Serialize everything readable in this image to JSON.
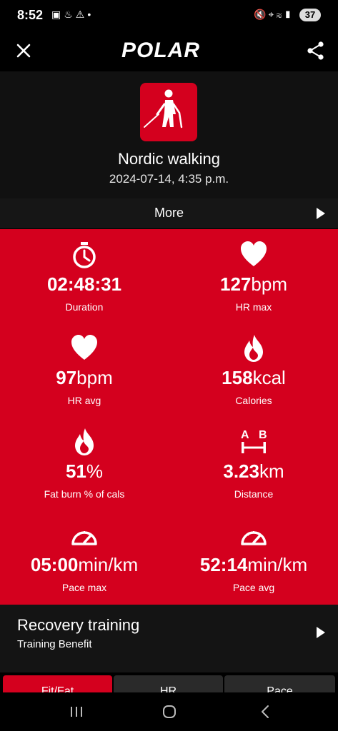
{
  "status_bar": {
    "time": "8:52",
    "left_icons": [
      "screenshot-icon",
      "flame-icon",
      "warning-icon",
      "dot-icon"
    ],
    "right_icons": [
      "mute-icon",
      "location-icon",
      "wifi-icon",
      "signal-icon"
    ],
    "battery": "37"
  },
  "app_bar": {
    "logo": "POLAR"
  },
  "session": {
    "sport": "Nordic walking",
    "date": "2024-07-14, 4:35 p.m.",
    "more_label": "More"
  },
  "stats": [
    {
      "icon": "stopwatch-icon",
      "value": "02:48:31",
      "unit": "",
      "label": "Duration"
    },
    {
      "icon": "heart-icon",
      "value": "127",
      "unit": "bpm",
      "label": "HR max"
    },
    {
      "icon": "heart-icon",
      "value": "97",
      "unit": "bpm",
      "label": "HR avg"
    },
    {
      "icon": "flame-icon",
      "value": "158",
      "unit": "kcal",
      "label": "Calories"
    },
    {
      "icon": "flame-icon",
      "value": "51",
      "unit": "%",
      "label": "Fat burn % of cals"
    },
    {
      "icon": "distance-ab-icon",
      "value": "3.23",
      "unit": "km",
      "label": "Distance"
    },
    {
      "icon": "speedometer-icon",
      "value": "05:00",
      "unit": "min/km",
      "label": "Pace max"
    },
    {
      "icon": "speedometer-icon",
      "value": "52:14",
      "unit": "min/km",
      "label": "Pace avg"
    }
  ],
  "benefit": {
    "title": "Recovery training",
    "subtitle": "Training Benefit"
  },
  "tabs": [
    "Fit/Fat",
    "HR",
    "Pace"
  ],
  "colors": {
    "accent": "#d4001e",
    "background": "#000000"
  }
}
